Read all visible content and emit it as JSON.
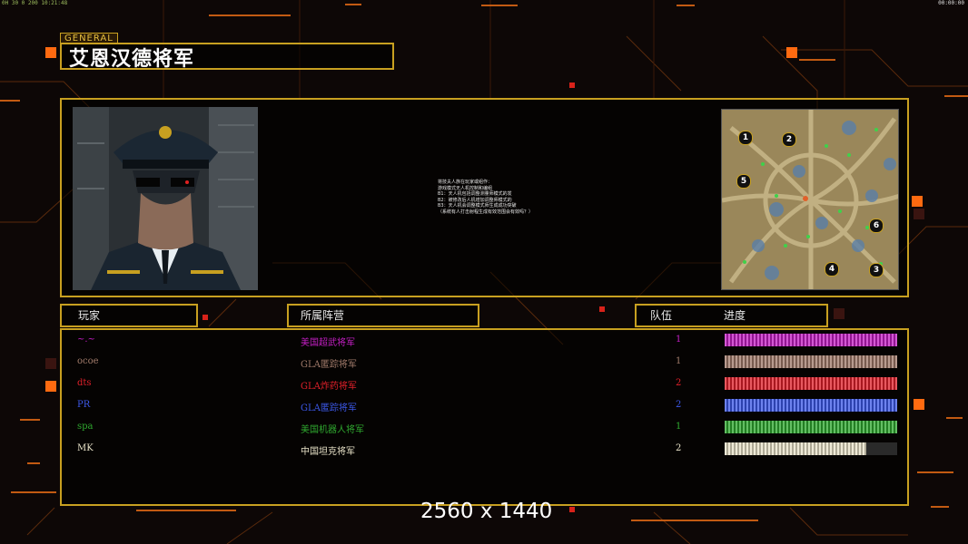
{
  "hud": {
    "top_left": "0H 30 0 200 10:21:48",
    "top_right": "00:00:00"
  },
  "general_tag": "GENERAL",
  "general_name": "艾恩汉德将军",
  "description_lines": [
    "将技夫人族在玩家或组作：",
    "游戏模式无人机控制和编组",
    "B1：天人机包括调整测量师模式的发",
    "B2：被修改后人机增加调整师模式的",
    "B3：天人机会调整模式师生成成功突破",
    "（系统有人打击射程生成有效范围会有效吗？）"
  ],
  "headers": {
    "player": "玩家",
    "faction": "所属阵营",
    "team": "队伍",
    "progress": "进度"
  },
  "players": [
    {
      "name": "~.~",
      "faction": "美国超武将军",
      "team": "1",
      "progress": 1.0,
      "color": "#c41fc4"
    },
    {
      "name": "ocoe",
      "faction": "GLA匿踪将军",
      "team": "1",
      "progress": 1.0,
      "color": "#a07a6a"
    },
    {
      "name": "dts",
      "faction": "GLA炸药将军",
      "team": "2",
      "progress": 1.0,
      "color": "#e0202a"
    },
    {
      "name": "PR",
      "faction": "GLA匿踪将军",
      "team": "2",
      "progress": 1.0,
      "color": "#3c58e8"
    },
    {
      "name": "spa",
      "faction": "美国机器人将军",
      "team": "1",
      "progress": 1.0,
      "color": "#2fa82f"
    },
    {
      "name": "MK",
      "faction": "中国坦克将军",
      "team": "2",
      "progress": 0.82,
      "color": "#e8e2c8"
    }
  ],
  "map_spawns": [
    "1",
    "2",
    "3",
    "4",
    "5",
    "6"
  ],
  "resolution_label": "2560 x 1440"
}
